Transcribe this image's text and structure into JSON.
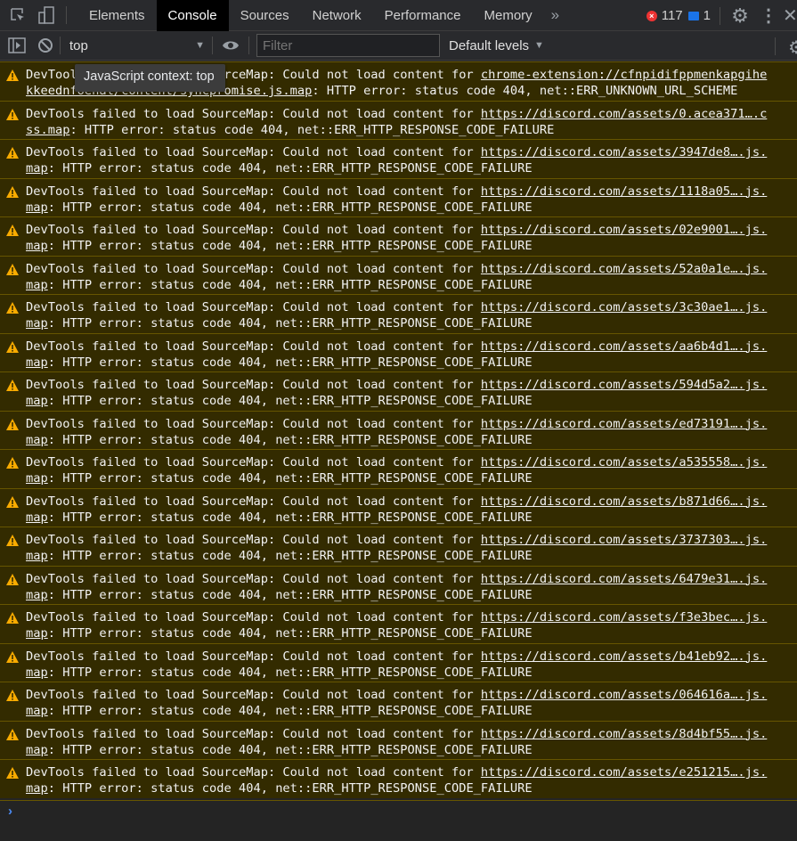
{
  "tabs": [
    "Elements",
    "Console",
    "Sources",
    "Network",
    "Performance",
    "Memory"
  ],
  "active_tab": "Console",
  "error_count": "117",
  "message_count": "1",
  "toolbar": {
    "context": "top",
    "filter_placeholder": "Filter",
    "levels": "Default levels"
  },
  "tooltip": "JavaScript context: top",
  "colors": {
    "warning_bg": "#332b00",
    "warning_border": "#665500",
    "warning_icon": "#f9ab00",
    "error": "#e33",
    "prompt": "#4b8bf5"
  },
  "messages": [
    {
      "prefix": "DevTools failed to load SourceMap: Could not load content for ",
      "link": "chrome-extension://cfnpidifppmenkapgihekkeednfoenal/content/syncpromise.js.map",
      "suffix": ": HTTP error: status code 404, net::ERR_UNKNOWN_URL_SCHEME"
    },
    {
      "prefix": "DevTools failed to load SourceMap: Could not load content for ",
      "link": "https://discord.com/assets/0.acea371….css.map",
      "suffix": ": HTTP error: status code 404, net::ERR_HTTP_RESPONSE_CODE_FAILURE"
    },
    {
      "prefix": "DevTools failed to load SourceMap: Could not load content for ",
      "link": "https://discord.com/assets/3947de8….js.map",
      "suffix": ": HTTP error: status code 404, net::ERR_HTTP_RESPONSE_CODE_FAILURE"
    },
    {
      "prefix": "DevTools failed to load SourceMap: Could not load content for ",
      "link": "https://discord.com/assets/1118a05….js.map",
      "suffix": ": HTTP error: status code 404, net::ERR_HTTP_RESPONSE_CODE_FAILURE"
    },
    {
      "prefix": "DevTools failed to load SourceMap: Could not load content for ",
      "link": "https://discord.com/assets/02e9001….js.map",
      "suffix": ": HTTP error: status code 404, net::ERR_HTTP_RESPONSE_CODE_FAILURE"
    },
    {
      "prefix": "DevTools failed to load SourceMap: Could not load content for ",
      "link": "https://discord.com/assets/52a0a1e….js.map",
      "suffix": ": HTTP error: status code 404, net::ERR_HTTP_RESPONSE_CODE_FAILURE"
    },
    {
      "prefix": "DevTools failed to load SourceMap: Could not load content for ",
      "link": "https://discord.com/assets/3c30ae1….js.map",
      "suffix": ": HTTP error: status code 404, net::ERR_HTTP_RESPONSE_CODE_FAILURE"
    },
    {
      "prefix": "DevTools failed to load SourceMap: Could not load content for ",
      "link": "https://discord.com/assets/aa6b4d1….js.map",
      "suffix": ": HTTP error: status code 404, net::ERR_HTTP_RESPONSE_CODE_FAILURE"
    },
    {
      "prefix": "DevTools failed to load SourceMap: Could not load content for ",
      "link": "https://discord.com/assets/594d5a2….js.map",
      "suffix": ": HTTP error: status code 404, net::ERR_HTTP_RESPONSE_CODE_FAILURE"
    },
    {
      "prefix": "DevTools failed to load SourceMap: Could not load content for ",
      "link": "https://discord.com/assets/ed73191….js.map",
      "suffix": ": HTTP error: status code 404, net::ERR_HTTP_RESPONSE_CODE_FAILURE"
    },
    {
      "prefix": "DevTools failed to load SourceMap: Could not load content for ",
      "link": "https://discord.com/assets/a535558….js.map",
      "suffix": ": HTTP error: status code 404, net::ERR_HTTP_RESPONSE_CODE_FAILURE"
    },
    {
      "prefix": "DevTools failed to load SourceMap: Could not load content for ",
      "link": "https://discord.com/assets/b871d66….js.map",
      "suffix": ": HTTP error: status code 404, net::ERR_HTTP_RESPONSE_CODE_FAILURE"
    },
    {
      "prefix": "DevTools failed to load SourceMap: Could not load content for ",
      "link": "https://discord.com/assets/3737303….js.map",
      "suffix": ": HTTP error: status code 404, net::ERR_HTTP_RESPONSE_CODE_FAILURE"
    },
    {
      "prefix": "DevTools failed to load SourceMap: Could not load content for ",
      "link": "https://discord.com/assets/6479e31….js.map",
      "suffix": ": HTTP error: status code 404, net::ERR_HTTP_RESPONSE_CODE_FAILURE"
    },
    {
      "prefix": "DevTools failed to load SourceMap: Could not load content for ",
      "link": "https://discord.com/assets/f3e3bec….js.map",
      "suffix": ": HTTP error: status code 404, net::ERR_HTTP_RESPONSE_CODE_FAILURE"
    },
    {
      "prefix": "DevTools failed to load SourceMap: Could not load content for ",
      "link": "https://discord.com/assets/b41eb92….js.map",
      "suffix": ": HTTP error: status code 404, net::ERR_HTTP_RESPONSE_CODE_FAILURE"
    },
    {
      "prefix": "DevTools failed to load SourceMap: Could not load content for ",
      "link": "https://discord.com/assets/064616a….js.map",
      "suffix": ": HTTP error: status code 404, net::ERR_HTTP_RESPONSE_CODE_FAILURE"
    },
    {
      "prefix": "DevTools failed to load SourceMap: Could not load content for ",
      "link": "https://discord.com/assets/8d4bf55….js.map",
      "suffix": ": HTTP error: status code 404, net::ERR_HTTP_RESPONSE_CODE_FAILURE"
    },
    {
      "prefix": "DevTools failed to load SourceMap: Could not load content for ",
      "link": "https://discord.com/assets/e251215….js.map",
      "suffix": ": HTTP error: status code 404, net::ERR_HTTP_RESPONSE_CODE_FAILURE"
    }
  ]
}
